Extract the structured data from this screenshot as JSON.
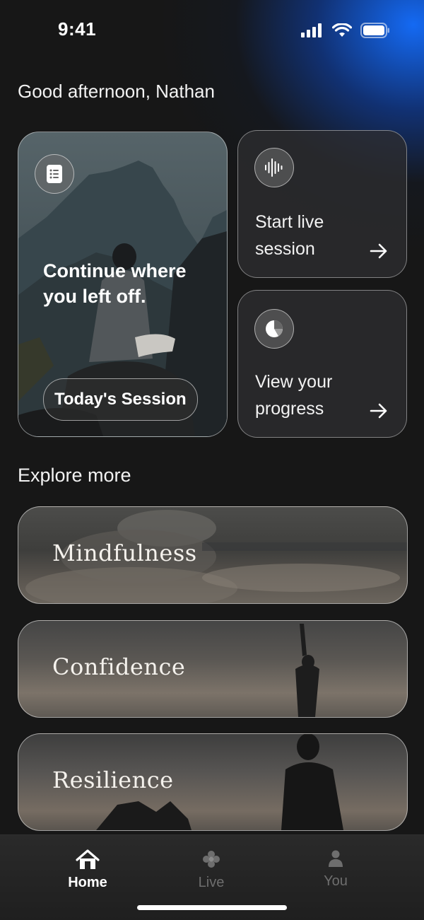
{
  "status_bar": {
    "time": "9:41"
  },
  "greeting": "Good afternoon, Nathan",
  "continue_card": {
    "title": "Continue where you left off.",
    "button_label": "Today's Session"
  },
  "side_cards": {
    "live": {
      "label": "Start live session"
    },
    "progress": {
      "label": "View your progress"
    }
  },
  "explore": {
    "title": "Explore more",
    "items": [
      {
        "label": "Mindfulness"
      },
      {
        "label": "Confidence"
      },
      {
        "label": "Resilience"
      }
    ]
  },
  "tab_bar": {
    "tabs": [
      {
        "label": "Home",
        "icon": "home-icon",
        "active": true
      },
      {
        "label": "Live",
        "icon": "flower-icon",
        "active": false
      },
      {
        "label": "You",
        "icon": "person-icon",
        "active": false
      }
    ]
  },
  "colors": {
    "background": "#171717",
    "accent_glow": "#1470ff",
    "tab_active": "#ffffff",
    "tab_inactive": "#6e6e6e"
  }
}
